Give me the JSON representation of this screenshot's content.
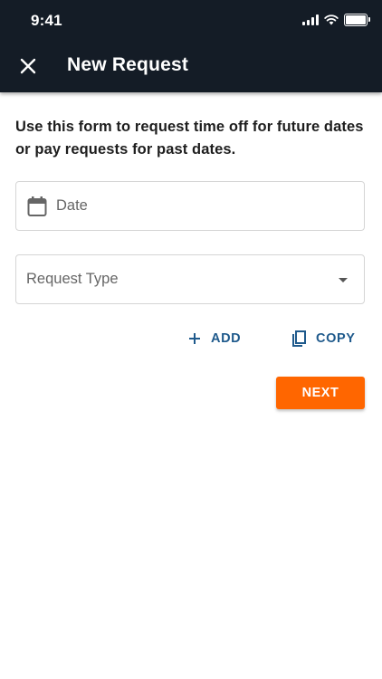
{
  "status_bar": {
    "time": "9:41"
  },
  "header": {
    "title": "New Request"
  },
  "intro": "Use this form to request time off for future dates or pay requests for past dates.",
  "date_field": {
    "placeholder": "Date"
  },
  "request_type": {
    "placeholder": "Request Type"
  },
  "actions": {
    "add_label": "ADD",
    "copy_label": "COPY"
  },
  "next_label": "NEXT",
  "colors": {
    "header_bg": "#141c26",
    "accent": "#1f5a8c",
    "next_bg": "#ff6600"
  },
  "icons": [
    "signal-icon",
    "wifi-icon",
    "battery-icon",
    "close-icon",
    "calendar-icon",
    "dropdown-arrow-icon",
    "plus-icon",
    "copy-icon"
  ]
}
